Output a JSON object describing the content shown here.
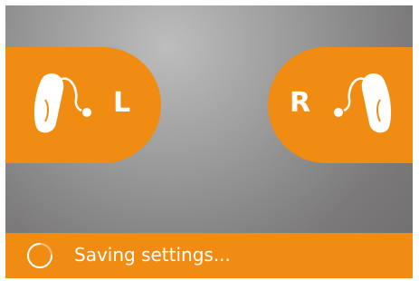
{
  "devices": {
    "left": {
      "label": "L",
      "icon": "hearing-aid-icon"
    },
    "right": {
      "label": "R",
      "icon": "hearing-aid-icon"
    }
  },
  "status": {
    "text": "Saving settings...",
    "icon": "spinner-icon"
  },
  "colors": {
    "accent": "#f08c12",
    "background": "#8a8888",
    "foreground": "#ffffff"
  }
}
